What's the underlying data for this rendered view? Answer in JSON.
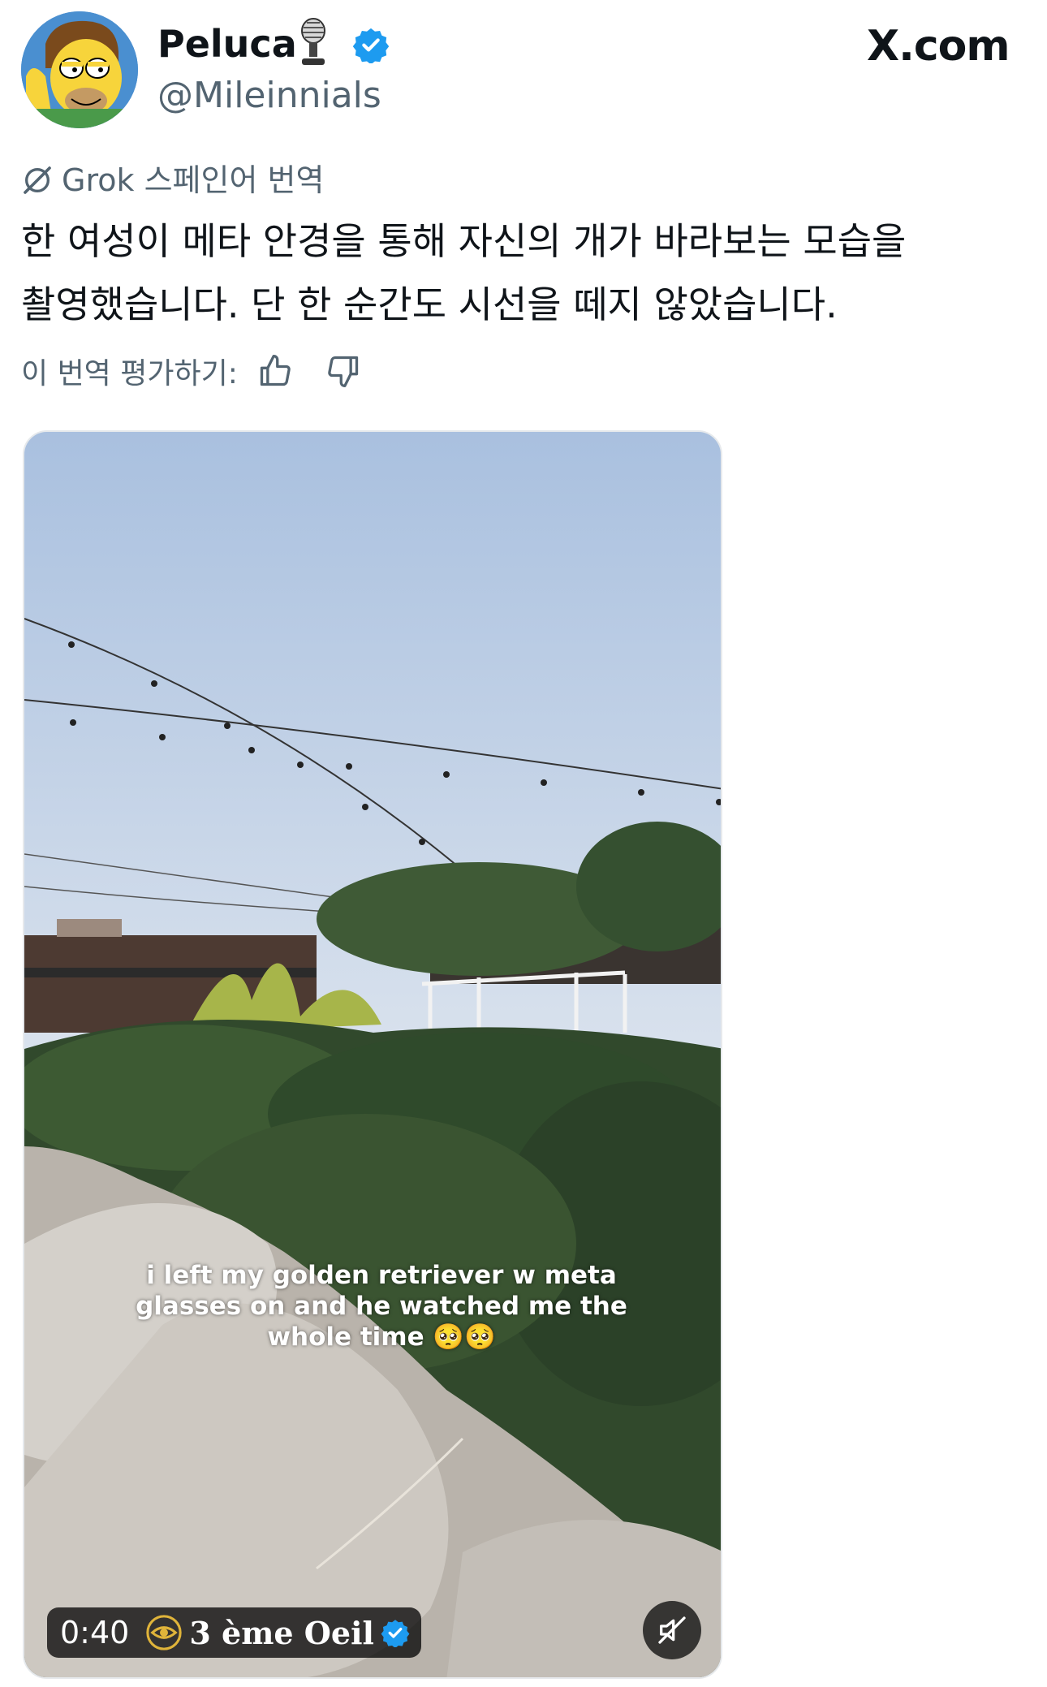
{
  "author": {
    "display_name": "Peluca",
    "handle": "@Mileinnials",
    "avatar_icon": "homer-simpson-avatar",
    "badges": [
      "microphone-emoji-icon",
      "verified-badge-icon"
    ],
    "verified_color": "#1d9bf0"
  },
  "site": {
    "logo_text": "X.com"
  },
  "translation": {
    "label": "Grok 스페인어 번역",
    "icon": "grok-icon",
    "text_lines": [
      "한 여성이 메타 안경을 통해 자신의 개가 바라보는 모습을",
      "촬영했습니다. 단 한 순간도 시선을 떼지 않았습니다."
    ],
    "rate_label": "이 번역 평가하기:",
    "rate_buttons": [
      "thumbs-up-icon",
      "thumbs-down-icon"
    ]
  },
  "media": {
    "caption_lines": [
      "i left my golden retriever w meta",
      "glasses on and he watched me the",
      "whole time 🥺🥺"
    ],
    "duration": "0:40",
    "source_name": "3 ème Oeil",
    "source_icon": "eye-icon",
    "mute_icon": "muted-speaker-icon"
  },
  "colors": {
    "text_primary": "#0f1419",
    "text_secondary": "#536471",
    "accent": "#1d9bf0"
  }
}
